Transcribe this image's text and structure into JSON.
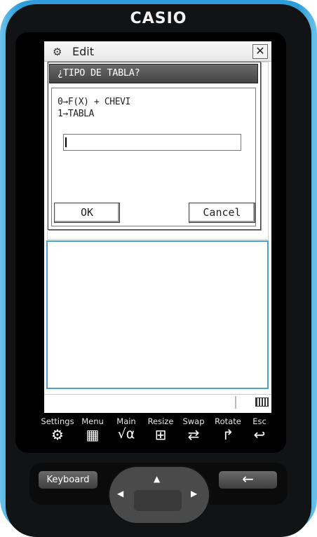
{
  "device": {
    "brand": "CASIO"
  },
  "screen": {
    "title": "Edit",
    "icons": {
      "settings": "gear-icon",
      "close": "close-icon"
    }
  },
  "dialog": {
    "title": "¿TIPO DE TABLA?",
    "message_line1": "0→F(X) + CHEVI",
    "message_line2": "1→TABLA",
    "input_value": "",
    "ok_label": "OK",
    "cancel_label": "Cancel"
  },
  "icon_bar": [
    {
      "label": "Settings",
      "icon": "⚙",
      "icon_name": "settings-icon"
    },
    {
      "label": "Menu",
      "icon": "▦",
      "icon_name": "menu-grid-icon"
    },
    {
      "label": "Main",
      "icon": "√α",
      "icon_name": "main-sqrt-alpha-icon"
    },
    {
      "label": "Resize",
      "icon": "⊞",
      "icon_name": "resize-icon"
    },
    {
      "label": "Swap",
      "icon": "⇄",
      "icon_name": "swap-icon"
    },
    {
      "label": "Rotate",
      "icon": "↱",
      "icon_name": "rotate-icon"
    },
    {
      "label": "Esc",
      "icon": "↩",
      "icon_name": "esc-icon"
    }
  ],
  "keys": {
    "keyboard_label": "Keyboard",
    "back_icon": "←"
  },
  "colors": {
    "accent_blue": "#2f9ed8",
    "panel_border": "#4aa0cf"
  }
}
